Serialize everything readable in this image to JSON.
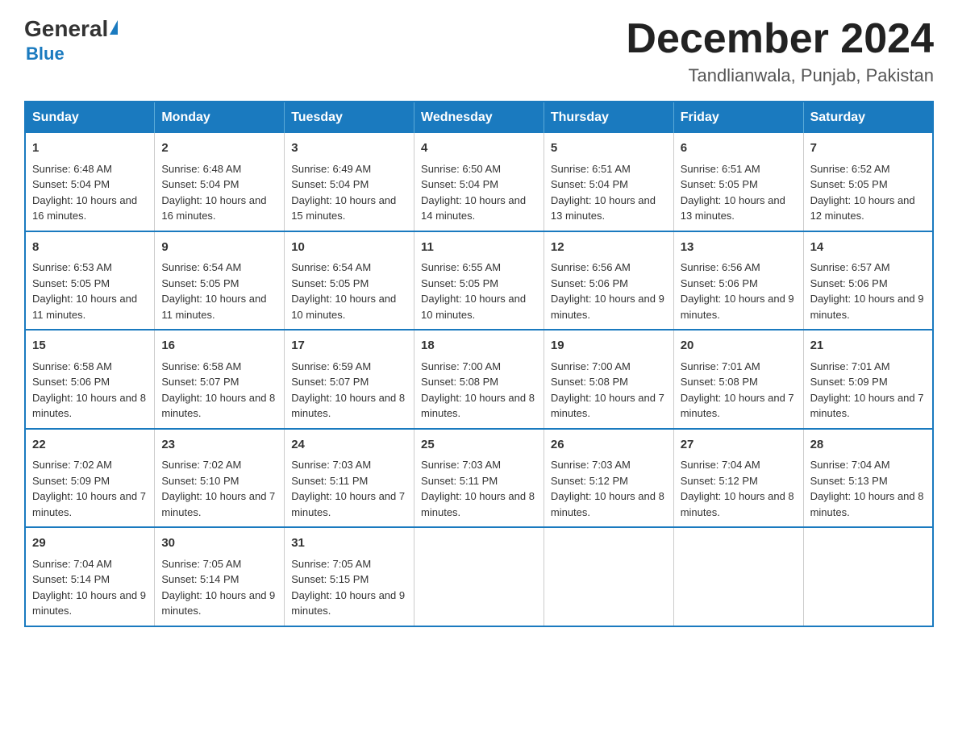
{
  "header": {
    "logo_general": "General",
    "logo_blue": "Blue",
    "main_title": "December 2024",
    "subtitle": "Tandlianwala, Punjab, Pakistan"
  },
  "days_of_week": [
    "Sunday",
    "Monday",
    "Tuesday",
    "Wednesday",
    "Thursday",
    "Friday",
    "Saturday"
  ],
  "weeks": [
    [
      {
        "day": "1",
        "sunrise": "6:48 AM",
        "sunset": "5:04 PM",
        "daylight": "10 hours and 16 minutes."
      },
      {
        "day": "2",
        "sunrise": "6:48 AM",
        "sunset": "5:04 PM",
        "daylight": "10 hours and 16 minutes."
      },
      {
        "day": "3",
        "sunrise": "6:49 AM",
        "sunset": "5:04 PM",
        "daylight": "10 hours and 15 minutes."
      },
      {
        "day": "4",
        "sunrise": "6:50 AM",
        "sunset": "5:04 PM",
        "daylight": "10 hours and 14 minutes."
      },
      {
        "day": "5",
        "sunrise": "6:51 AM",
        "sunset": "5:04 PM",
        "daylight": "10 hours and 13 minutes."
      },
      {
        "day": "6",
        "sunrise": "6:51 AM",
        "sunset": "5:05 PM",
        "daylight": "10 hours and 13 minutes."
      },
      {
        "day": "7",
        "sunrise": "6:52 AM",
        "sunset": "5:05 PM",
        "daylight": "10 hours and 12 minutes."
      }
    ],
    [
      {
        "day": "8",
        "sunrise": "6:53 AM",
        "sunset": "5:05 PM",
        "daylight": "10 hours and 11 minutes."
      },
      {
        "day": "9",
        "sunrise": "6:54 AM",
        "sunset": "5:05 PM",
        "daylight": "10 hours and 11 minutes."
      },
      {
        "day": "10",
        "sunrise": "6:54 AM",
        "sunset": "5:05 PM",
        "daylight": "10 hours and 10 minutes."
      },
      {
        "day": "11",
        "sunrise": "6:55 AM",
        "sunset": "5:05 PM",
        "daylight": "10 hours and 10 minutes."
      },
      {
        "day": "12",
        "sunrise": "6:56 AM",
        "sunset": "5:06 PM",
        "daylight": "10 hours and 9 minutes."
      },
      {
        "day": "13",
        "sunrise": "6:56 AM",
        "sunset": "5:06 PM",
        "daylight": "10 hours and 9 minutes."
      },
      {
        "day": "14",
        "sunrise": "6:57 AM",
        "sunset": "5:06 PM",
        "daylight": "10 hours and 9 minutes."
      }
    ],
    [
      {
        "day": "15",
        "sunrise": "6:58 AM",
        "sunset": "5:06 PM",
        "daylight": "10 hours and 8 minutes."
      },
      {
        "day": "16",
        "sunrise": "6:58 AM",
        "sunset": "5:07 PM",
        "daylight": "10 hours and 8 minutes."
      },
      {
        "day": "17",
        "sunrise": "6:59 AM",
        "sunset": "5:07 PM",
        "daylight": "10 hours and 8 minutes."
      },
      {
        "day": "18",
        "sunrise": "7:00 AM",
        "sunset": "5:08 PM",
        "daylight": "10 hours and 8 minutes."
      },
      {
        "day": "19",
        "sunrise": "7:00 AM",
        "sunset": "5:08 PM",
        "daylight": "10 hours and 7 minutes."
      },
      {
        "day": "20",
        "sunrise": "7:01 AM",
        "sunset": "5:08 PM",
        "daylight": "10 hours and 7 minutes."
      },
      {
        "day": "21",
        "sunrise": "7:01 AM",
        "sunset": "5:09 PM",
        "daylight": "10 hours and 7 minutes."
      }
    ],
    [
      {
        "day": "22",
        "sunrise": "7:02 AM",
        "sunset": "5:09 PM",
        "daylight": "10 hours and 7 minutes."
      },
      {
        "day": "23",
        "sunrise": "7:02 AM",
        "sunset": "5:10 PM",
        "daylight": "10 hours and 7 minutes."
      },
      {
        "day": "24",
        "sunrise": "7:03 AM",
        "sunset": "5:11 PM",
        "daylight": "10 hours and 7 minutes."
      },
      {
        "day": "25",
        "sunrise": "7:03 AM",
        "sunset": "5:11 PM",
        "daylight": "10 hours and 8 minutes."
      },
      {
        "day": "26",
        "sunrise": "7:03 AM",
        "sunset": "5:12 PM",
        "daylight": "10 hours and 8 minutes."
      },
      {
        "day": "27",
        "sunrise": "7:04 AM",
        "sunset": "5:12 PM",
        "daylight": "10 hours and 8 minutes."
      },
      {
        "day": "28",
        "sunrise": "7:04 AM",
        "sunset": "5:13 PM",
        "daylight": "10 hours and 8 minutes."
      }
    ],
    [
      {
        "day": "29",
        "sunrise": "7:04 AM",
        "sunset": "5:14 PM",
        "daylight": "10 hours and 9 minutes."
      },
      {
        "day": "30",
        "sunrise": "7:05 AM",
        "sunset": "5:14 PM",
        "daylight": "10 hours and 9 minutes."
      },
      {
        "day": "31",
        "sunrise": "7:05 AM",
        "sunset": "5:15 PM",
        "daylight": "10 hours and 9 minutes."
      },
      null,
      null,
      null,
      null
    ]
  ],
  "labels": {
    "sunrise_prefix": "Sunrise: ",
    "sunset_prefix": "Sunset: ",
    "daylight_prefix": "Daylight: "
  }
}
